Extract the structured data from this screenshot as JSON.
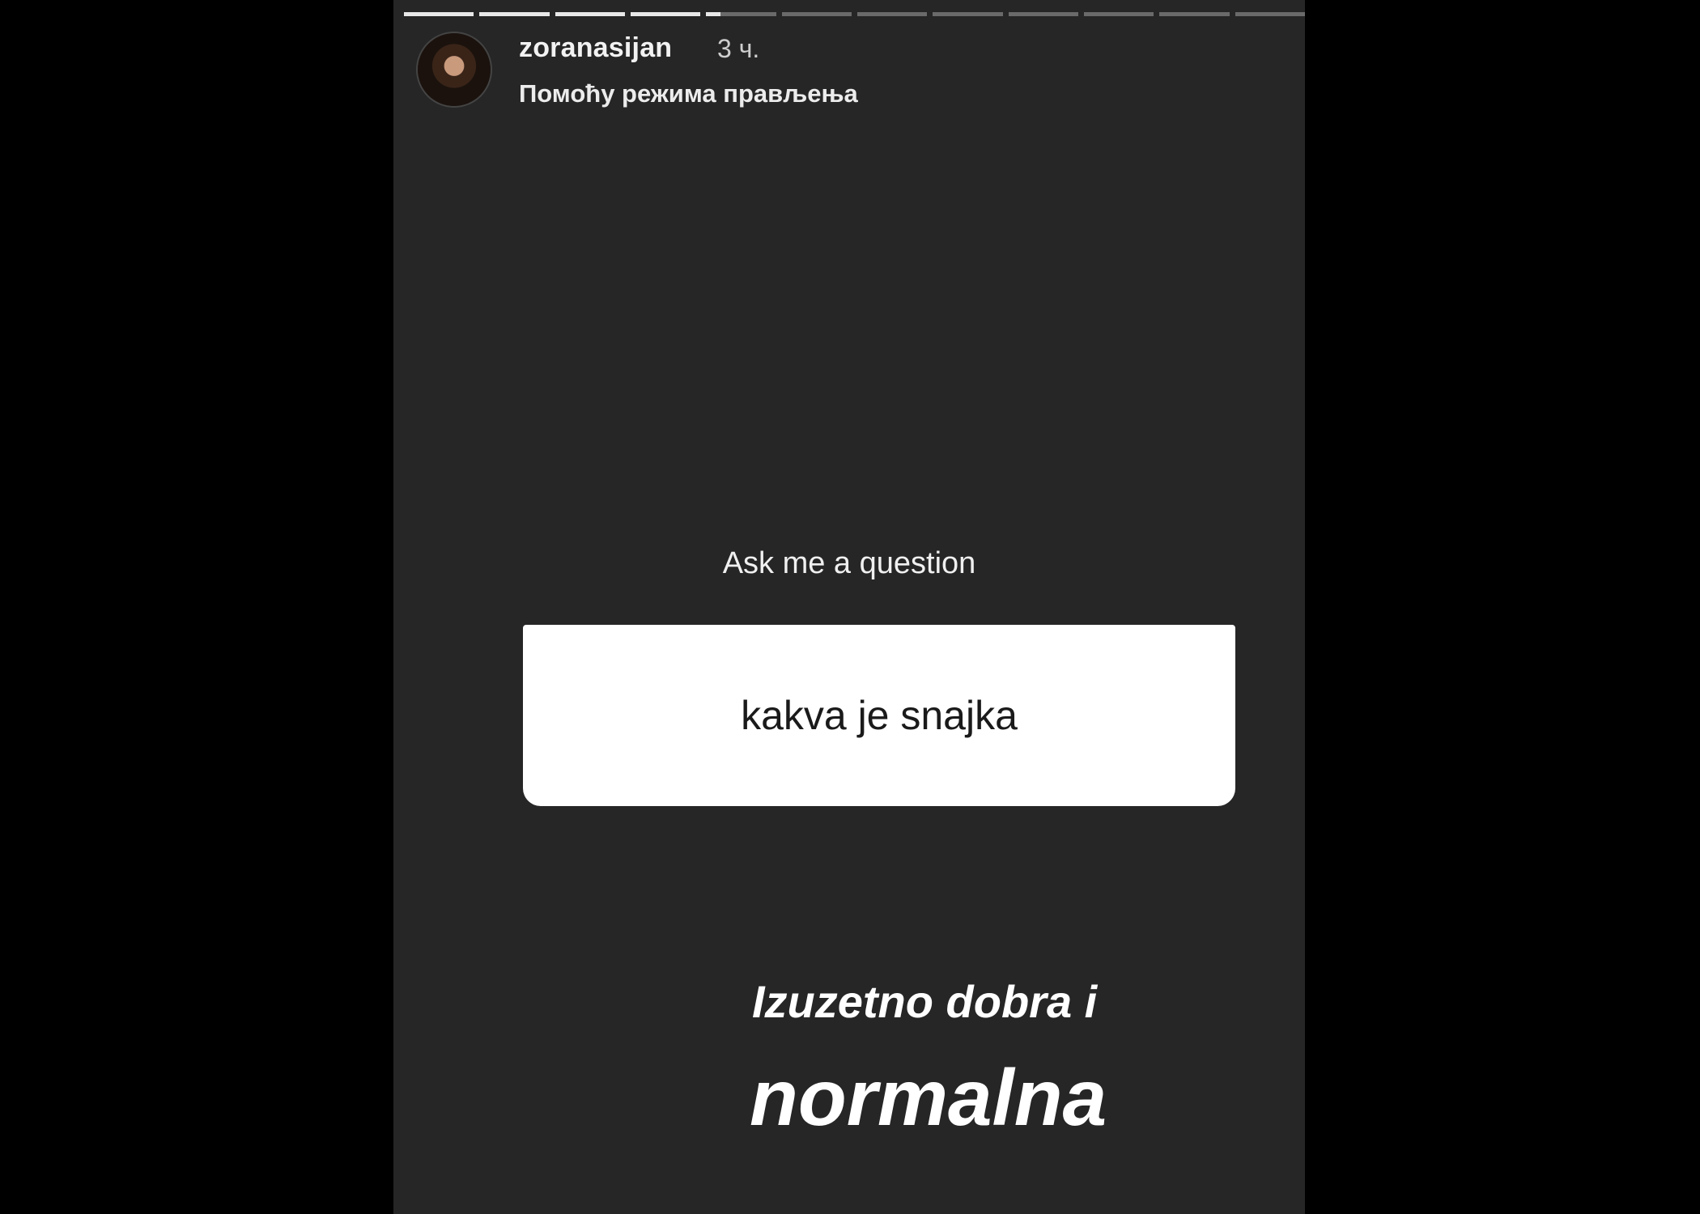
{
  "story": {
    "progress_segments": 12,
    "progress": {
      "completed_segments": 4,
      "current_segment_fraction": 0.2
    },
    "header": {
      "username": "zoranasijan",
      "time": "3 ч.",
      "subtitle": "Помоћу режима прављења",
      "avatar_icon": "profile-photo-avatar"
    },
    "question_sticker": {
      "label": "Ask me a question",
      "question": "kakva je snajka"
    },
    "answer": {
      "line1": "Izuzetno dobra i",
      "line2": "normalna"
    }
  }
}
